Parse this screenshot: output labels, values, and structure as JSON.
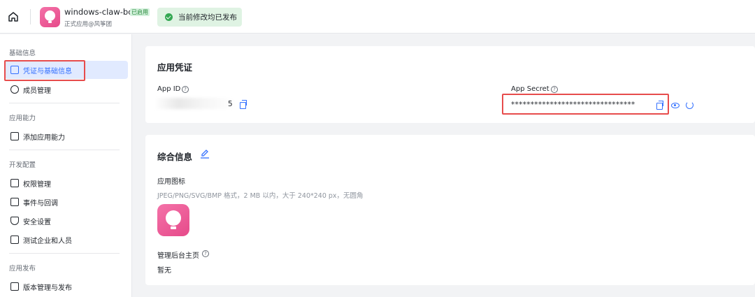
{
  "header": {
    "app_name": "windows-claw-bot",
    "app_badge": "已启用",
    "app_subtitle": "正式应用@风筝团",
    "publish_status": "当前修改均已发布"
  },
  "sidebar": {
    "groups": [
      {
        "title": "基础信息",
        "items": [
          "凭证与基础信息",
          "成员管理"
        ]
      },
      {
        "title": "应用能力",
        "items": [
          "添加应用能力"
        ]
      },
      {
        "title": "开发配置",
        "items": [
          "权限管理",
          "事件与回调",
          "安全设置",
          "测试企业和人员"
        ]
      },
      {
        "title": "应用发布",
        "items": [
          "版本管理与发布"
        ]
      }
    ],
    "active_item": "凭证与基础信息"
  },
  "credentials": {
    "title": "应用凭证",
    "app_id_label": "App ID",
    "app_id_value": "5",
    "app_secret_label": "App Secret",
    "app_secret_value": "********************************"
  },
  "general": {
    "title": "综合信息",
    "icon_label": "应用图标",
    "icon_hint": "JPEG/PNG/SVG/BMP 格式，2 MB 以内，大于 240*240 px，无圆角",
    "homepage_label": "管理后台主页",
    "homepage_value": "暂无"
  },
  "colors": {
    "accent": "#3370ff",
    "highlight_box": "#e74c4c",
    "brand_pink": "#e64a8a"
  }
}
